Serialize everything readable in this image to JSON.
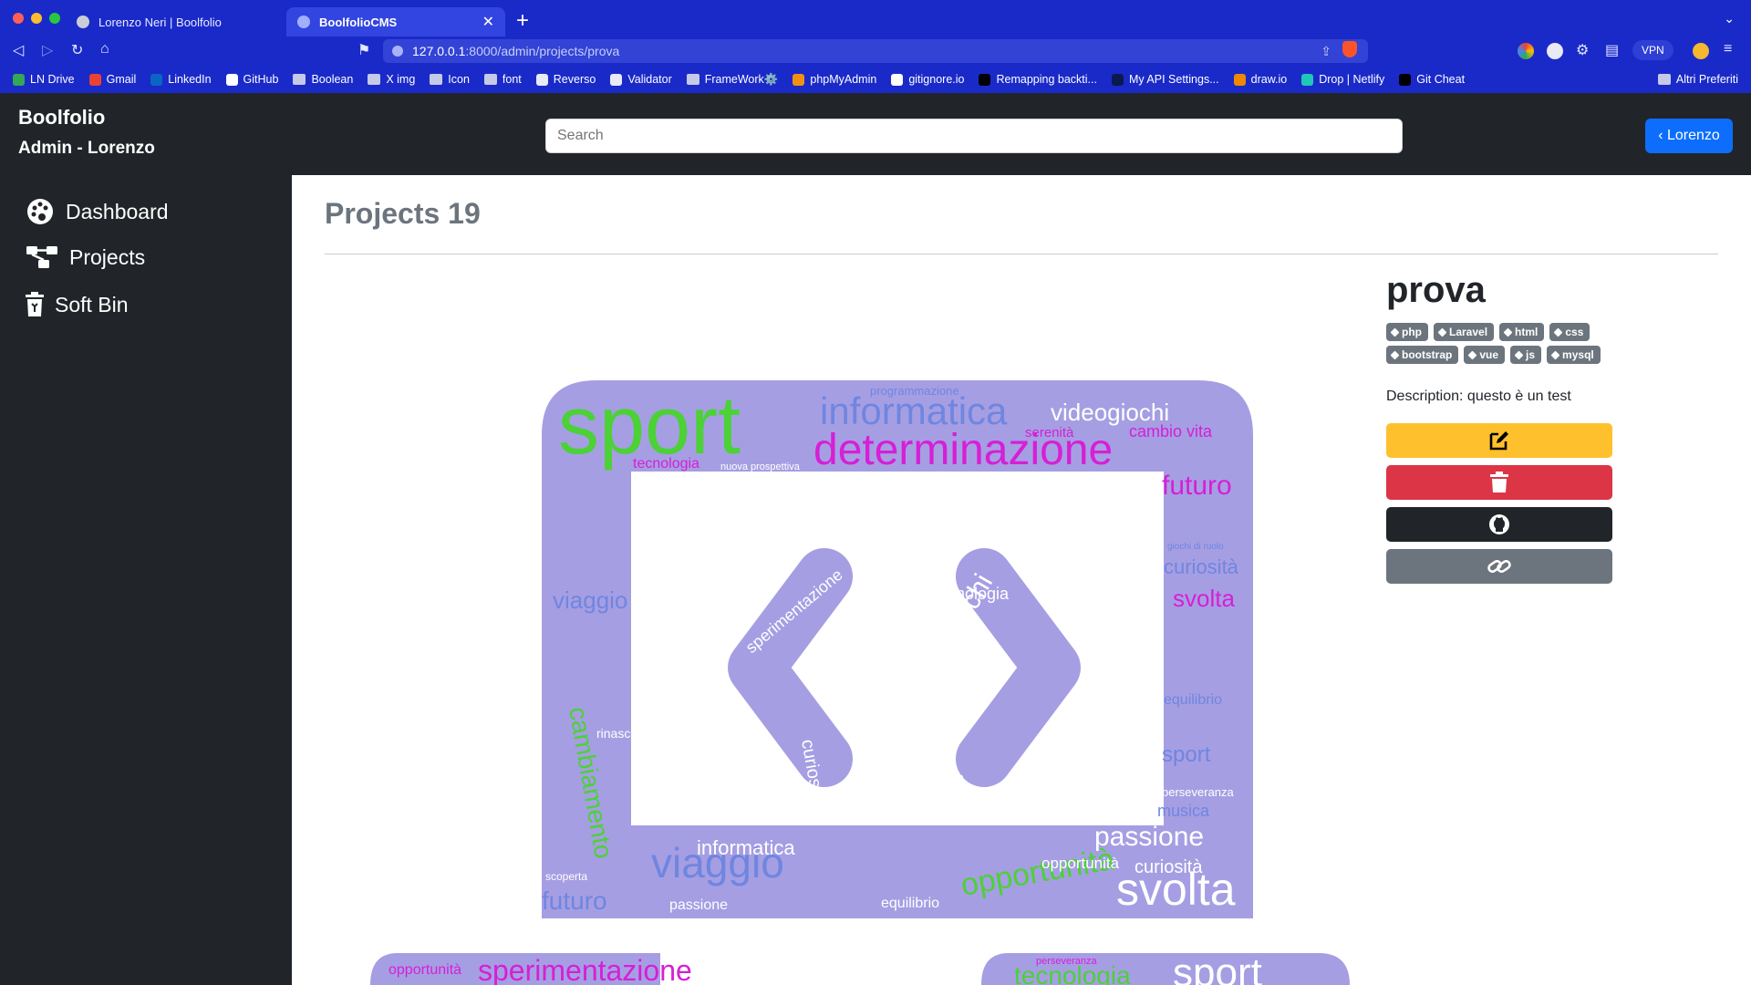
{
  "browser": {
    "tabs": [
      {
        "title": "Lorenzo Neri | Boolfolio"
      },
      {
        "title": "BoolfolioCMS",
        "active": true
      }
    ],
    "url_host": "127.0.0.1",
    "url_path": ":8000/admin/projects/prova",
    "vpn_label": "VPN",
    "bookmarks": [
      {
        "label": "LN Drive",
        "icon": "drive-icon",
        "color": "#34a853"
      },
      {
        "label": "Gmail",
        "icon": "gmail-icon",
        "color": "#ea4335"
      },
      {
        "label": "LinkedIn",
        "icon": "linkedin-icon",
        "color": "#0a66c2"
      },
      {
        "label": "GitHub",
        "icon": "github-icon",
        "color": "#ffffff"
      },
      {
        "label": "Boolean",
        "icon": "folder-icon",
        "color": "#c5cae9"
      },
      {
        "label": "X img",
        "icon": "folder-icon",
        "color": "#c5cae9"
      },
      {
        "label": "Icon",
        "icon": "folder-icon",
        "color": "#c5cae9"
      },
      {
        "label": "font",
        "icon": "folder-icon",
        "color": "#c5cae9"
      },
      {
        "label": "Reverso",
        "icon": "reverso-icon",
        "color": "#e8eaf6"
      },
      {
        "label": "Validator",
        "icon": "w3c-icon",
        "color": "#e8eaf6"
      },
      {
        "label": "FrameWork⚙️",
        "icon": "folder-icon",
        "color": "#c5cae9"
      },
      {
        "label": "phpMyAdmin",
        "icon": "phpmyadmin-icon",
        "color": "#f29111"
      },
      {
        "label": "gitignore.io",
        "icon": "gitignore-icon",
        "color": "#ffffff"
      },
      {
        "label": "Remapping backti...",
        "icon": "medium-icon",
        "color": "#000000"
      },
      {
        "label": "My API Settings...",
        "icon": "api-icon",
        "color": "#0b1a4e"
      },
      {
        "label": "draw.io",
        "icon": "drawio-icon",
        "color": "#f08705"
      },
      {
        "label": "Drop | Netlify",
        "icon": "netlify-icon",
        "color": "#20c6b7"
      },
      {
        "label": "Git Cheat",
        "icon": "gitcheat-icon",
        "color": "#000000"
      }
    ],
    "bookmarks_other": "Altri Preferiti"
  },
  "header": {
    "brand_line1": "Boolfolio",
    "brand_line2": "Admin - Lorenzo",
    "search_placeholder": "Search",
    "user_button": "‹ Lorenzo"
  },
  "sidebar": {
    "items": [
      {
        "label": "Dashboard",
        "icon": "palette-icon"
      },
      {
        "label": "Projects",
        "icon": "diagram-icon"
      },
      {
        "label": "Soft Bin",
        "icon": "trash-icon"
      }
    ]
  },
  "main": {
    "title": "Projects 19",
    "project": {
      "name": "prova",
      "tags": [
        "php",
        "Laravel",
        "html",
        "css",
        "bootstrap",
        "vue",
        "js",
        "mysql"
      ],
      "description": "Description: questo è un test",
      "actions": [
        {
          "name": "edit-button",
          "icon": "edit-icon",
          "color": "#ffc02d"
        },
        {
          "name": "delete-button",
          "icon": "trash-icon",
          "color": "#dc3545"
        },
        {
          "name": "github-button",
          "icon": "github-icon",
          "color": "#212529"
        },
        {
          "name": "link-button",
          "icon": "link-icon",
          "color": "#6c757d"
        }
      ]
    },
    "wordcloud_words": [
      "sport",
      "informatica",
      "determinazione",
      "videogiochi",
      "cambio vita",
      "programmazione",
      "tecnologia",
      "nuova prospettiva",
      "serenità",
      "futuro",
      "curiosità",
      "svolta",
      "viaggio",
      "cambiamento",
      "sperimentazione",
      "rinascita",
      "equilibrio",
      "passione",
      "opportunità",
      "musica",
      "scoperta",
      "perseveranza",
      "giochi di ruolo"
    ],
    "wordcloud_bottom_words": [
      "opportunità",
      "sperimentazione",
      "perseveranza",
      "tecnologia",
      "sport"
    ]
  },
  "colors": {
    "chrome": "#1a2ac9",
    "dark": "#212529",
    "primary": "#0d6efd",
    "cloud_bg": "#a69ee3",
    "word_green": "#4cd137",
    "word_magenta": "#d61fd6",
    "word_white": "#ffffff",
    "word_blue": "#6f86e0"
  }
}
